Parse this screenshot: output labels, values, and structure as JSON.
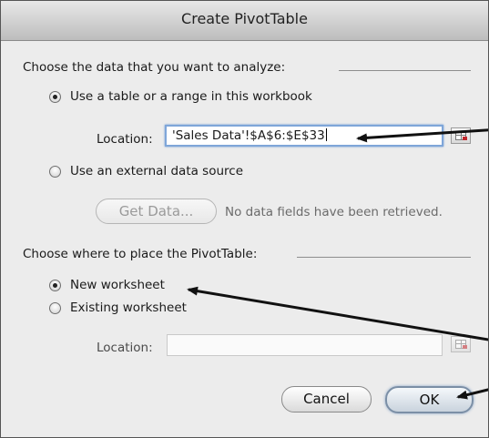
{
  "window": {
    "title": "Create PivotTable"
  },
  "source_section": {
    "heading": "Choose the data that you want to analyze:",
    "option_table": "Use a table or a range in this workbook",
    "location_label": "Location:",
    "location_value": "'Sales Data'!$A$6:$E$33",
    "option_external": "Use an external data source",
    "get_data_label": "Get Data...",
    "get_data_status": "No data fields have been retrieved."
  },
  "place_section": {
    "heading": "Choose where to place the PivotTable:",
    "option_new": "New worksheet",
    "option_existing": "Existing worksheet",
    "location_label": "Location:",
    "location_value": ""
  },
  "buttons": {
    "cancel": "Cancel",
    "ok": "OK"
  },
  "state": {
    "source_selected": "table",
    "place_selected": "new"
  },
  "colors": {
    "focus_ring": "#7fa6d9",
    "arrow": "#111111",
    "range_icon_accent": "#c0272d"
  },
  "icons": {
    "range_button": "range-select-icon",
    "pointer": "annotation-arrow"
  }
}
